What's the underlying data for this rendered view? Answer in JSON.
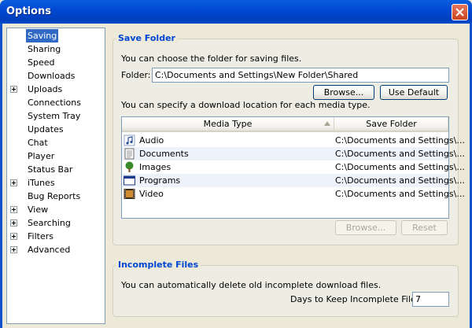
{
  "window": {
    "title": "Options"
  },
  "nav": {
    "items": [
      {
        "label": "Saving",
        "expandable": false,
        "selected": true
      },
      {
        "label": "Sharing",
        "expandable": false
      },
      {
        "label": "Speed",
        "expandable": false
      },
      {
        "label": "Downloads",
        "expandable": false
      },
      {
        "label": "Uploads",
        "expandable": true
      },
      {
        "label": "Connections",
        "expandable": false
      },
      {
        "label": "System Tray",
        "expandable": false
      },
      {
        "label": "Updates",
        "expandable": false
      },
      {
        "label": "Chat",
        "expandable": false
      },
      {
        "label": "Player",
        "expandable": false
      },
      {
        "label": "Status Bar",
        "expandable": false
      },
      {
        "label": "iTunes",
        "expandable": true
      },
      {
        "label": "Bug Reports",
        "expandable": false
      },
      {
        "label": "View",
        "expandable": true
      },
      {
        "label": "Searching",
        "expandable": true
      },
      {
        "label": "Filters",
        "expandable": true
      },
      {
        "label": "Advanced",
        "expandable": true
      }
    ]
  },
  "save_folder": {
    "title": "Save Folder",
    "intro": "You can choose the folder for saving files.",
    "folder_label": "Folder:",
    "folder_value": "C:\\Documents and Settings\\New Folder\\Shared",
    "browse_label": "Browse...",
    "default_label": "Use Default",
    "media_intro": "You can specify a download location for each media type.",
    "columns": {
      "type": "Media Type",
      "folder": "Save Folder"
    },
    "rows": [
      {
        "type": "Audio",
        "folder": "C:\\Documents and Settings\\...",
        "icon": "audio-note-icon"
      },
      {
        "type": "Documents",
        "folder": "C:\\Documents and Settings\\...",
        "icon": "document-icon"
      },
      {
        "type": "Images",
        "folder": "C:\\Documents and Settings\\...",
        "icon": "image-tree-icon"
      },
      {
        "type": "Programs",
        "folder": "C:\\Documents and Settings\\...",
        "icon": "program-window-icon"
      },
      {
        "type": "Video",
        "folder": "C:\\Documents and Settings\\...",
        "icon": "video-film-icon"
      }
    ],
    "row_browse_label": "Browse...",
    "reset_label": "Reset"
  },
  "incomplete": {
    "title": "Incomplete Files",
    "intro": "You can automatically delete old incomplete download files.",
    "days_label": "Days to Keep Incomplete Files:",
    "days_value": "7"
  },
  "colors": {
    "accent": "#0046d5",
    "selection": "#316ac5",
    "title_bar": "#0048d0"
  }
}
